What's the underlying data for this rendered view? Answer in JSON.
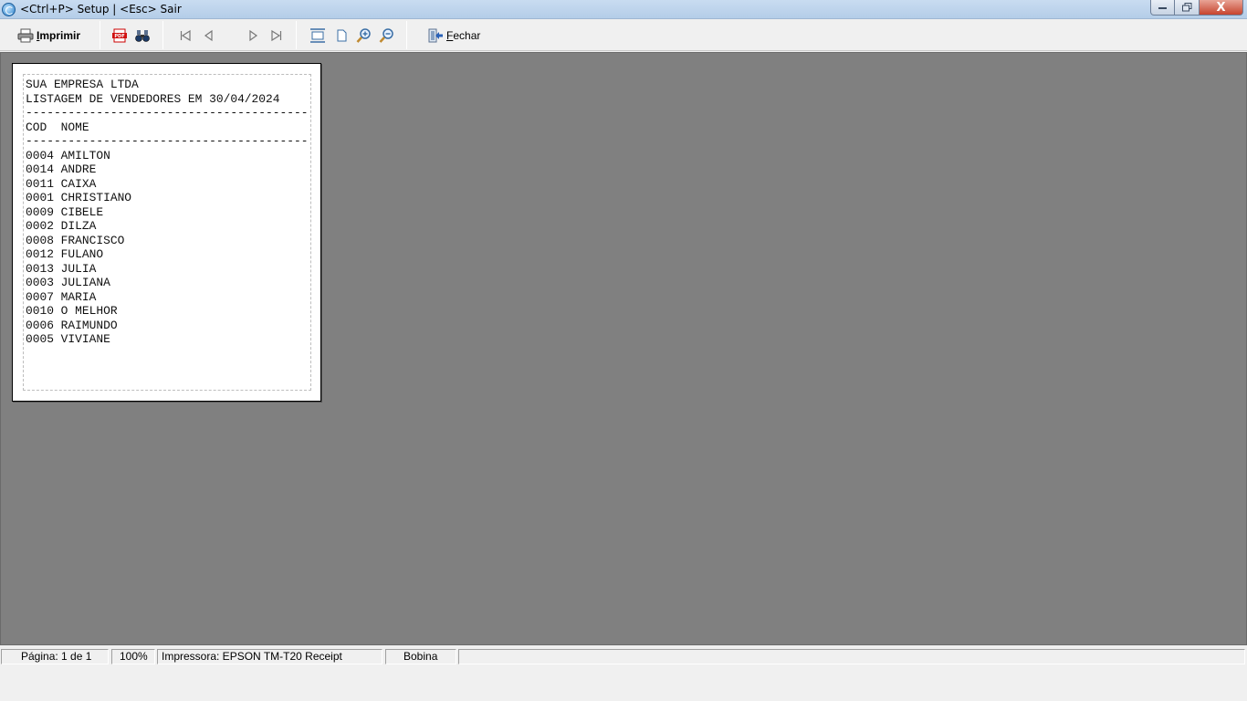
{
  "window": {
    "title": "<Ctrl+P> Setup | <Esc> Sair",
    "close_glyph": "X"
  },
  "toolbar": {
    "print_label": "Imprimir",
    "close_label": "Fechar"
  },
  "report": {
    "lines": [
      "SUA EMPRESA LTDA",
      "LISTAGEM DE VENDEDORES EM 30/04/2024",
      "----------------------------------------",
      "COD  NOME",
      "----------------------------------------",
      "0004 AMILTON",
      "0014 ANDRE",
      "0011 CAIXA",
      "0001 CHRISTIANO",
      "0009 CIBELE",
      "0002 DILZA",
      "0008 FRANCISCO",
      "0012 FULANO",
      "0013 JULIA",
      "0003 JULIANA",
      "0007 MARIA",
      "0010 O MELHOR",
      "0006 RAIMUNDO",
      "0005 VIVIANE"
    ]
  },
  "statusbar": {
    "page": "Página: 1 de 1",
    "zoom": "100%",
    "printer": "Impressora: EPSON TM-T20 Receipt",
    "paper": "Bobina",
    "extra": ""
  },
  "colors": {
    "preview_bg": "#808080",
    "titlebar": "#b9d1ea",
    "close_button": "#c7442e"
  }
}
